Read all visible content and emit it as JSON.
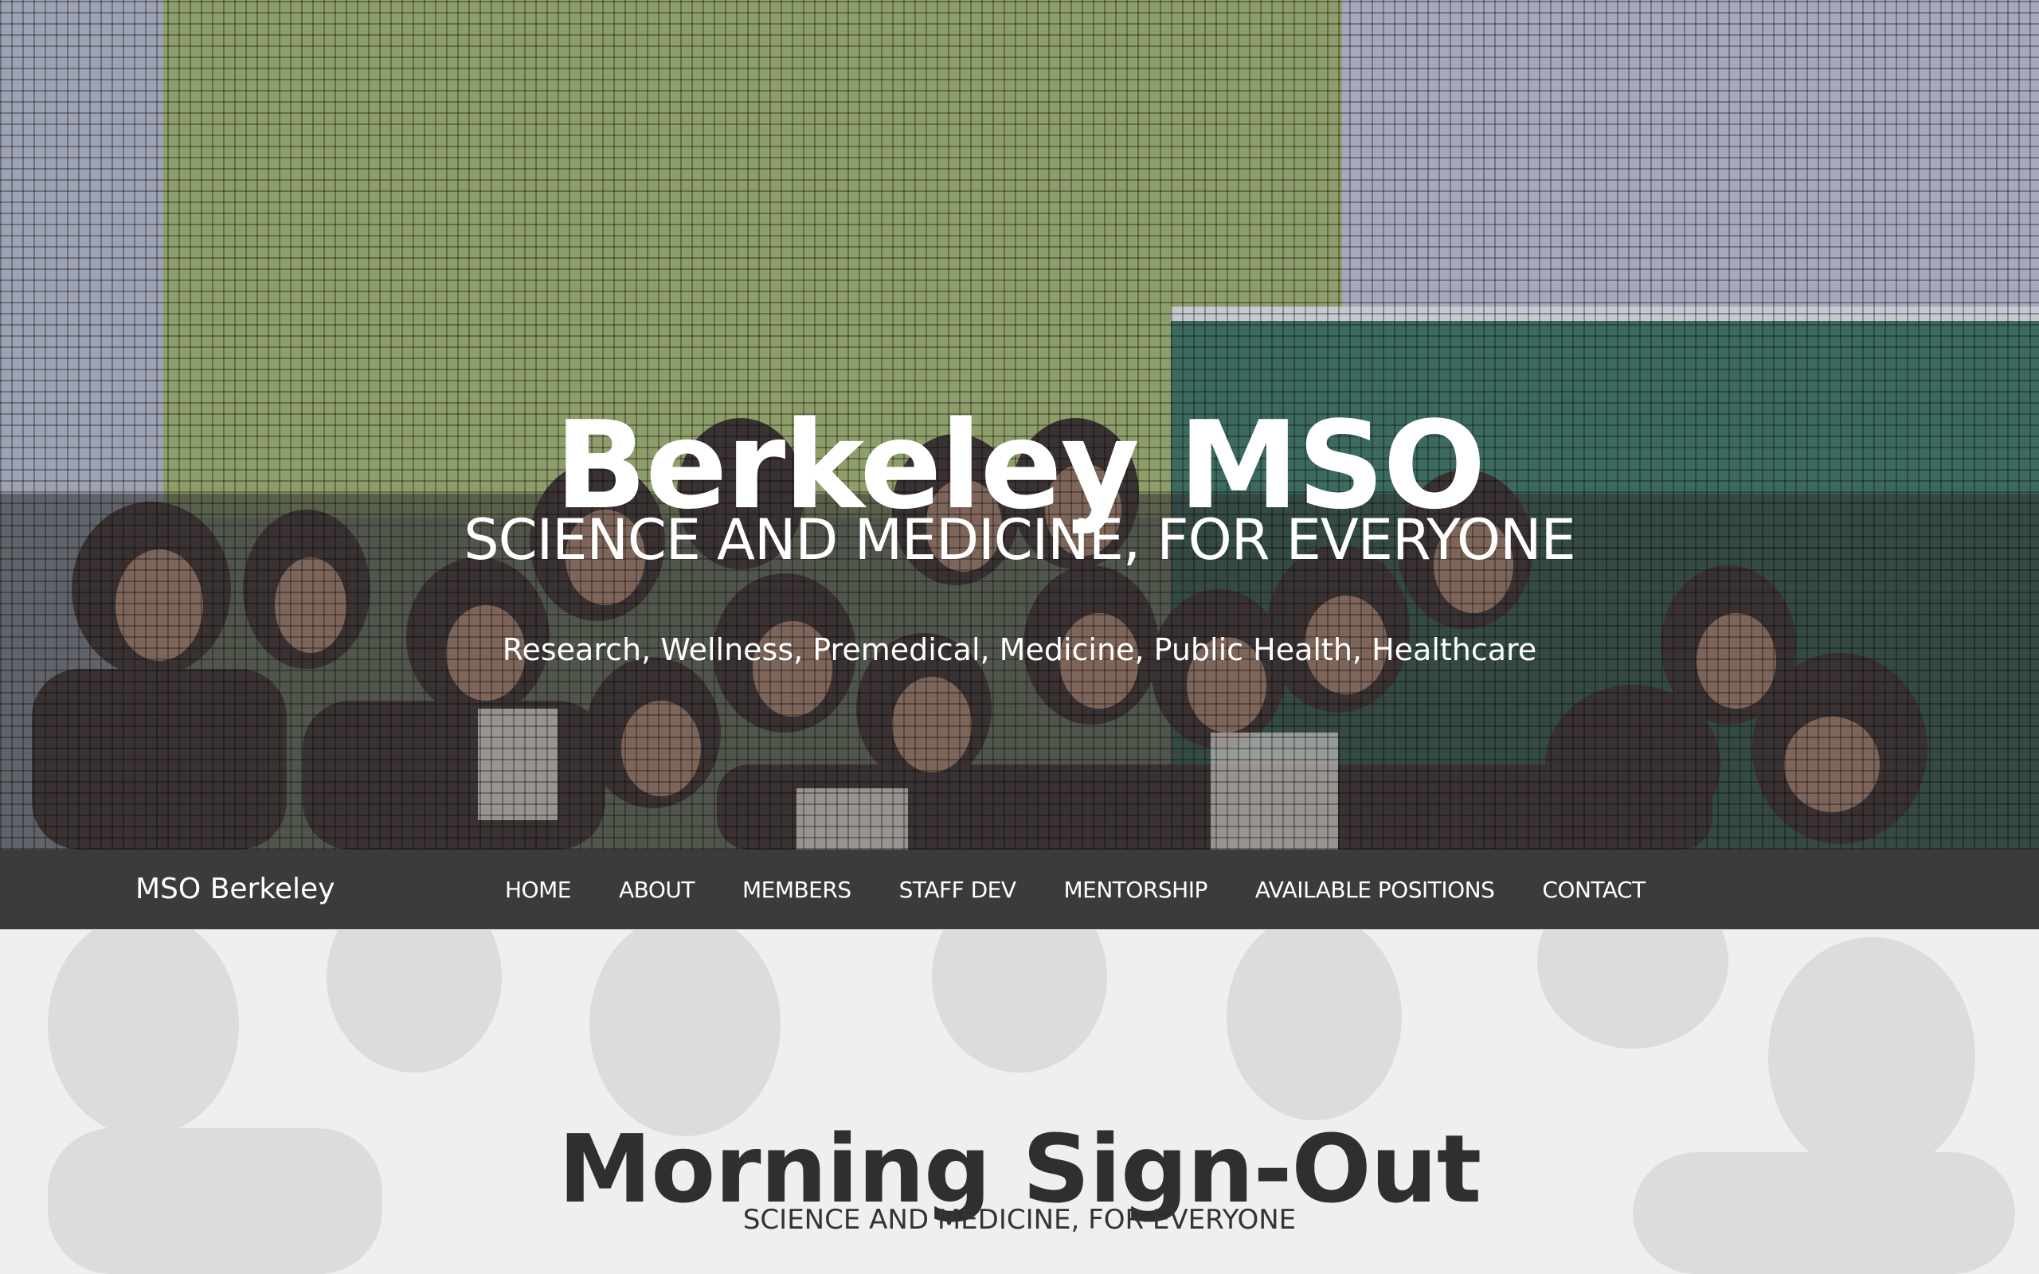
{
  "hero": {
    "title": "Berkeley MSO",
    "tagline": "SCIENCE AND MEDICINE, FOR EVERYONE",
    "topics": "Research, Wellness, Premedical, Medicine, Public Health, Healthcare"
  },
  "navbar": {
    "brand": "MSO Berkeley",
    "links": [
      {
        "label": "HOME"
      },
      {
        "label": "ABOUT"
      },
      {
        "label": "MEMBERS"
      },
      {
        "label": "STAFF DEV"
      },
      {
        "label": "MENTORSHIP"
      },
      {
        "label": "AVAILABLE POSITIONS"
      },
      {
        "label": "CONTACT"
      }
    ]
  },
  "section": {
    "title": "Morning Sign-Out",
    "subtitle": "SCIENCE AND MEDICINE, FOR EVERYONE"
  },
  "colors": {
    "navbar_bg": "#3b3b3b",
    "lower_bg": "#efefef",
    "heading_text": "#2f2f2f"
  }
}
